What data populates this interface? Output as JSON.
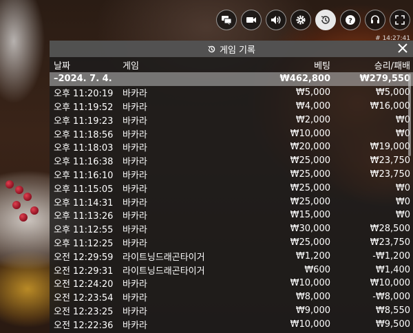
{
  "clock": "# 14:27:41",
  "toolbar": {
    "buttons": [
      {
        "name": "chat-icon"
      },
      {
        "name": "video-icon"
      },
      {
        "name": "volume-icon"
      },
      {
        "name": "settings-icon"
      },
      {
        "name": "history-icon",
        "active": true
      },
      {
        "name": "help-icon"
      },
      {
        "name": "lobby-icon"
      },
      {
        "name": "fullscreen-icon"
      }
    ]
  },
  "panel": {
    "title": "게임 기록",
    "columns": {
      "date": "날짜",
      "game": "게임",
      "bet": "베팅",
      "win": "승리/패배"
    },
    "summary": {
      "date": "–2024. 7. 4.",
      "bet": "₩462,800",
      "win": "₩279,550"
    },
    "rows": [
      {
        "date": "오후 11:20:19",
        "game": "바카라",
        "bet": "₩5,000",
        "win": "₩5,000"
      },
      {
        "date": "오후 11:19:52",
        "game": "바카라",
        "bet": "₩4,000",
        "win": "₩16,000"
      },
      {
        "date": "오후 11:19:23",
        "game": "바카라",
        "bet": "₩2,000",
        "win": "₩0"
      },
      {
        "date": "오후 11:18:56",
        "game": "바카라",
        "bet": "₩10,000",
        "win": "₩0"
      },
      {
        "date": "오후 11:18:03",
        "game": "바카라",
        "bet": "₩20,000",
        "win": "₩19,000"
      },
      {
        "date": "오후 11:16:38",
        "game": "바카라",
        "bet": "₩25,000",
        "win": "₩23,750"
      },
      {
        "date": "오후 11:16:10",
        "game": "바카라",
        "bet": "₩25,000",
        "win": "₩23,750"
      },
      {
        "date": "오후 11:15:05",
        "game": "바카라",
        "bet": "₩25,000",
        "win": "₩0"
      },
      {
        "date": "오후 11:14:31",
        "game": "바카라",
        "bet": "₩25,000",
        "win": "₩0"
      },
      {
        "date": "오후 11:13:26",
        "game": "바카라",
        "bet": "₩15,000",
        "win": "₩0"
      },
      {
        "date": "오후 11:12:55",
        "game": "바카라",
        "bet": "₩30,000",
        "win": "₩28,500"
      },
      {
        "date": "오후 11:12:25",
        "game": "바카라",
        "bet": "₩25,000",
        "win": "₩23,750"
      },
      {
        "date": "오전 12:29:59",
        "game": "라이트닝드래곤타이거",
        "bet": "₩1,200",
        "win": "-₩1,200"
      },
      {
        "date": "오전 12:29:31",
        "game": "라이트닝드래곤타이거",
        "bet": "₩600",
        "win": "₩1,400"
      },
      {
        "date": "오전 12:24:20",
        "game": "바카라",
        "bet": "₩10,000",
        "win": "₩10,000"
      },
      {
        "date": "오전 12:23:54",
        "game": "바카라",
        "bet": "₩8,000",
        "win": "-₩8,000"
      },
      {
        "date": "오전 12:23:25",
        "game": "바카라",
        "bet": "₩9,000",
        "win": "₩8,550"
      },
      {
        "date": "오전 12:22:36",
        "game": "바카라",
        "bet": "₩10,000",
        "win": "₩9,500"
      }
    ]
  }
}
